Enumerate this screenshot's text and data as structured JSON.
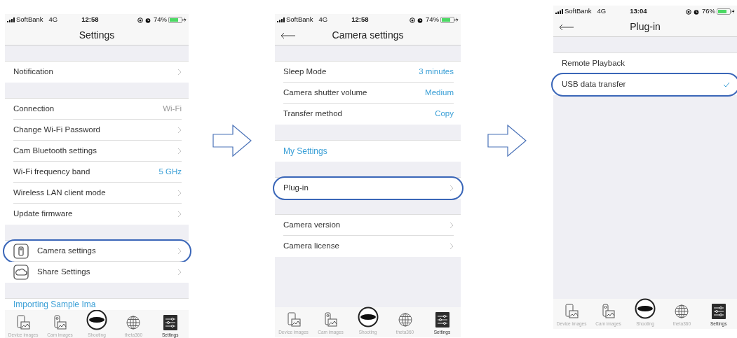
{
  "screens": [
    {
      "status": {
        "carrier": "SoftBank",
        "network": "4G",
        "time": "12:58",
        "battery": "74%"
      },
      "title": "Settings",
      "back": false,
      "sections": [
        [
          {
            "kind": "nav",
            "label": "Notification",
            "highlighted": false
          }
        ],
        [
          {
            "kind": "value",
            "label": "Connection",
            "value": "Wi-Fi",
            "accent": false,
            "highlighted": false
          },
          {
            "kind": "nav",
            "label": "Change Wi-Fi Password",
            "highlighted": false
          },
          {
            "kind": "nav",
            "label": "Cam Bluetooth settings",
            "highlighted": false
          },
          {
            "kind": "value",
            "label": "Wi-Fi frequency band",
            "value": "5 GHz",
            "accent": true,
            "highlighted": false
          },
          {
            "kind": "nav",
            "label": "Wireless LAN client mode",
            "highlighted": false
          },
          {
            "kind": "nav",
            "label": "Update firmware",
            "highlighted": false
          }
        ],
        [
          {
            "kind": "camera",
            "label": "Camera settings",
            "highlighted": true
          },
          {
            "kind": "cloud",
            "label": "Share Settings",
            "highlighted": false
          }
        ],
        [
          {
            "kind": "footer_link",
            "label": "Importing Sample Ima",
            "highlighted": false
          }
        ]
      ],
      "tabs": [
        {
          "kind": "device",
          "label": "Device images",
          "selected": false
        },
        {
          "kind": "cam",
          "label": "Cam images",
          "selected": false
        },
        {
          "kind": "shoot",
          "label": "Shooting",
          "selected": false
        },
        {
          "kind": "globe",
          "label": "theta360",
          "selected": false
        },
        {
          "kind": "settings",
          "label": "Settings",
          "selected": true
        }
      ]
    },
    {
      "status": {
        "carrier": "SoftBank",
        "network": "4G",
        "time": "12:58",
        "battery": "74%"
      },
      "title": "Camera settings",
      "back": true,
      "sections": [
        [
          {
            "kind": "value",
            "label": "Sleep Mode",
            "value": "3 minutes",
            "accent": true,
            "highlighted": false
          },
          {
            "kind": "value",
            "label": "Camera shutter volume",
            "value": "Medium",
            "accent": true,
            "highlighted": false
          },
          {
            "kind": "value",
            "label": "Transfer method",
            "value": "Copy",
            "accent": true,
            "highlighted": false
          }
        ],
        [
          {
            "kind": "link",
            "label": "My Settings",
            "highlighted": false
          }
        ],
        [
          {
            "kind": "nav",
            "label": "Plug-in",
            "highlighted": true
          }
        ],
        [
          {
            "kind": "nav",
            "label": "Camera version",
            "highlighted": false
          },
          {
            "kind": "nav",
            "label": "Camera license",
            "highlighted": false
          }
        ]
      ],
      "tabs": [
        {
          "kind": "device",
          "label": "Device images",
          "selected": false
        },
        {
          "kind": "cam",
          "label": "Cam images",
          "selected": false
        },
        {
          "kind": "shoot",
          "label": "Shooting",
          "selected": false
        },
        {
          "kind": "globe",
          "label": "theta360",
          "selected": false
        },
        {
          "kind": "settings",
          "label": "Settings",
          "selected": true
        }
      ]
    },
    {
      "status": {
        "carrier": "SoftBank",
        "network": "4G",
        "time": "13:04",
        "battery": "76%"
      },
      "title": "Plug-in",
      "back": true,
      "sections": [
        [
          {
            "kind": "check",
            "label": "Remote Playback",
            "checked": false,
            "highlighted": false
          },
          {
            "kind": "check",
            "label": "USB data transfer",
            "checked": true,
            "highlighted": true
          }
        ]
      ],
      "tabs": [
        {
          "kind": "device",
          "label": "Device images",
          "selected": false
        },
        {
          "kind": "cam",
          "label": "Cam images",
          "selected": false
        },
        {
          "kind": "shoot",
          "label": "Shooting",
          "selected": false
        },
        {
          "kind": "globe",
          "label": "theta360",
          "selected": false
        },
        {
          "kind": "settings",
          "label": "Settings",
          "selected": true
        }
      ]
    }
  ]
}
